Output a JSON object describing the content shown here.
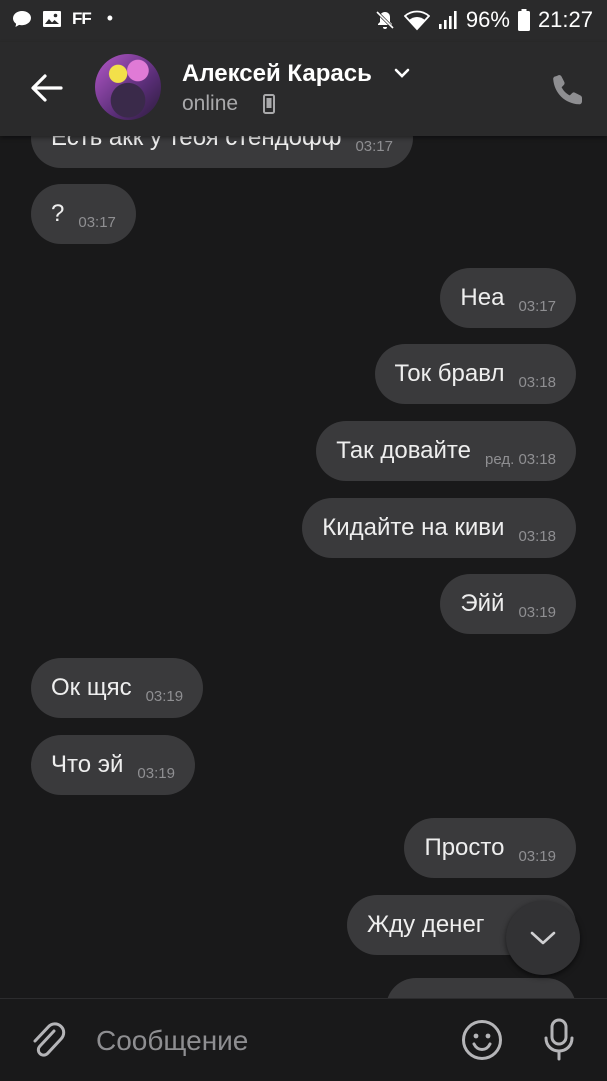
{
  "status_bar": {
    "left_icons": [
      "chat-notification-icon",
      "gallery-notification-icon"
    ],
    "ff_label": "FF",
    "dot": "•",
    "battery": "96%",
    "time": "21:27"
  },
  "header": {
    "contact_name": "Алексей Карась",
    "presence": "online"
  },
  "messages": [
    {
      "dir": "in",
      "text": "Есть акк у тебя стендофф",
      "time": "03:17"
    },
    {
      "dir": "in",
      "text": "?",
      "time": "03:17"
    },
    {
      "dir": "out",
      "text": "Неа",
      "time": "03:17"
    },
    {
      "dir": "out",
      "text": "Ток бравл",
      "time": "03:18"
    },
    {
      "dir": "out",
      "text": "Так довайте",
      "time": "ред. 03:18"
    },
    {
      "dir": "out",
      "text": "Кидайте на киви",
      "time": "03:18"
    },
    {
      "dir": "out",
      "text": "Эйй",
      "time": "03:19"
    },
    {
      "dir": "in",
      "text": "Ок щяс",
      "time": "03:19"
    },
    {
      "dir": "in",
      "text": "Что эй",
      "time": "03:19"
    },
    {
      "dir": "out",
      "text": "Просто",
      "time": "03:19"
    },
    {
      "dir": "out",
      "text": "Жду денег",
      "time": ""
    },
    {
      "dir": "out",
      "text": "",
      "time": ""
    }
  ],
  "composer": {
    "placeholder": "Сообщение"
  },
  "colors": {
    "background": "#19191a",
    "bar": "#2a2a2b",
    "bubble": "#3a3a3c"
  }
}
